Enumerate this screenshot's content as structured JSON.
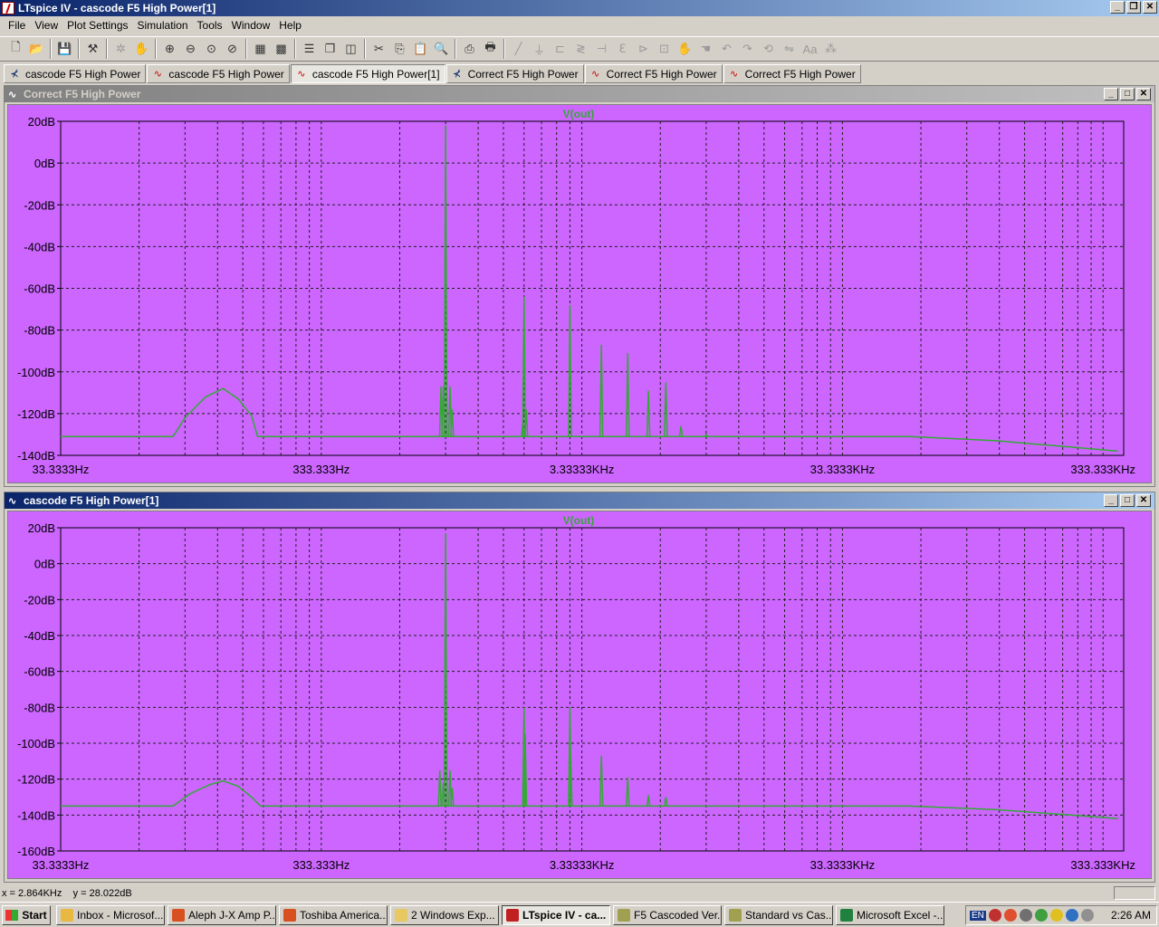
{
  "window": {
    "title": "LTspice IV - cascode F5 High Power[1]"
  },
  "menu": [
    "File",
    "View",
    "Plot Settings",
    "Simulation",
    "Tools",
    "Window",
    "Help"
  ],
  "toolbar_icons": [
    "new-schematic-icon",
    "open-icon",
    "save-icon",
    "control-panel-icon",
    "run-icon",
    "halt-icon",
    "zoom-in-icon",
    "zoom-out-icon",
    "zoom-fit-icon",
    "zoom-cancel-icon",
    "autorange-icon",
    "grid-icon",
    "tile-horizontal-icon",
    "cascade-icon",
    "tile-vertical-icon",
    "cut-icon",
    "copy-icon",
    "paste-icon",
    "find-icon",
    "print-preview-icon",
    "print-icon",
    "wire-icon",
    "ground-icon",
    "label-icon",
    "resistor-icon",
    "capacitor-icon",
    "inductor-icon",
    "diode-icon",
    "component-icon",
    "move-icon",
    "drag-icon",
    "undo-icon",
    "redo-icon",
    "rotate-icon",
    "mirror-icon",
    "text-icon",
    "spice-directive-icon"
  ],
  "tabs": [
    {
      "label": "cascode F5 High Power",
      "icon": "schematic-icon"
    },
    {
      "label": "cascode F5 High Power",
      "icon": "waveform-icon"
    },
    {
      "label": "cascode F5 High Power[1]",
      "icon": "waveform-icon"
    },
    {
      "label": "Correct F5 High Power",
      "icon": "schematic-icon"
    },
    {
      "label": "Correct F5 High Power",
      "icon": "waveform-icon"
    },
    {
      "label": "Correct F5 High Power",
      "icon": "waveform-icon"
    }
  ],
  "plots": [
    {
      "title": "Correct F5 High Power",
      "active": false,
      "trace_label": "V(out)",
      "colors": {
        "background": "#cc66ff",
        "trace": "#33aa33",
        "grid": "#202020"
      },
      "chart_data": {
        "type": "line",
        "x_scale": "log",
        "xlim_hz": [
          33.3333,
          400000
        ],
        "x_tick_labels": [
          "33.3333Hz",
          "333.333Hz",
          "3.33333KHz",
          "33.3333KHz",
          "333.333KHz"
        ],
        "x_tick_values": [
          33.3333,
          333.333,
          3333.33,
          33333.3,
          333333
        ],
        "ylim": [
          -140,
          20
        ],
        "y_tick_labels": [
          "20dB",
          "0dB",
          "-20dB",
          "-40dB",
          "-60dB",
          "-80dB",
          "-100dB",
          "-120dB",
          "-140dB"
        ],
        "y_tick_values": [
          20,
          0,
          -20,
          -40,
          -60,
          -80,
          -100,
          -120,
          -140
        ],
        "grid": true,
        "series": [
          {
            "name": "V(out)",
            "floor": [
              [
                33.3333,
                -131
              ],
              [
                90,
                -131
              ],
              [
                100,
                -122
              ],
              [
                120,
                -112
              ],
              [
                140,
                -108
              ],
              [
                160,
                -113
              ],
              [
                180,
                -121
              ],
              [
                190,
                -131
              ],
              [
                950,
                -131
              ],
              [
                20000,
                -131
              ],
              [
                60000,
                -131
              ],
              [
                130000,
                -133
              ],
              [
                250000,
                -136
              ],
              [
                380000,
                -138
              ]
            ],
            "spikes": [
              [
                960,
                -107
              ],
              [
                980,
                -107
              ],
              [
                1000,
                18
              ],
              [
                1040,
                -107
              ],
              [
                1060,
                -118
              ],
              [
                1980,
                -124
              ],
              [
                2000,
                -64
              ],
              [
                2040,
                -118
              ],
              [
                3000,
                -68
              ],
              [
                3960,
                -87
              ],
              [
                5000,
                -91
              ],
              [
                6000,
                -109
              ],
              [
                7000,
                -105
              ],
              [
                8000,
                -126
              ],
              [
                10000,
                -130
              ]
            ]
          }
        ]
      }
    },
    {
      "title": "cascode F5 High Power[1]",
      "active": true,
      "trace_label": "V(out)",
      "colors": {
        "background": "#cc66ff",
        "trace": "#33aa33",
        "grid": "#202020"
      },
      "chart_data": {
        "type": "line",
        "x_scale": "log",
        "xlim_hz": [
          33.3333,
          400000
        ],
        "x_tick_labels": [
          "33.3333Hz",
          "333.333Hz",
          "3.33333KHz",
          "33.3333KHz",
          "333.333KHz"
        ],
        "x_tick_values": [
          33.3333,
          333.333,
          3333.33,
          33333.3,
          333333
        ],
        "ylim": [
          -160,
          20
        ],
        "y_tick_labels": [
          "20dB",
          "0dB",
          "-20dB",
          "-40dB",
          "-60dB",
          "-80dB",
          "-100dB",
          "-120dB",
          "-140dB",
          "-160dB"
        ],
        "y_tick_values": [
          20,
          0,
          -20,
          -40,
          -60,
          -80,
          -100,
          -120,
          -140,
          -160
        ],
        "grid": true,
        "series": [
          {
            "name": "V(out)",
            "floor": [
              [
                33.3333,
                -135
              ],
              [
                90,
                -135
              ],
              [
                105,
                -128
              ],
              [
                125,
                -123
              ],
              [
                140,
                -121
              ],
              [
                160,
                -124
              ],
              [
                180,
                -130
              ],
              [
                195,
                -135
              ],
              [
                950,
                -135
              ],
              [
                20000,
                -135
              ],
              [
                60000,
                -135
              ],
              [
                130000,
                -137
              ],
              [
                250000,
                -140
              ],
              [
                380000,
                -142
              ]
            ],
            "spikes": [
              [
                950,
                -115
              ],
              [
                980,
                -122
              ],
              [
                1000,
                17
              ],
              [
                1040,
                -115
              ],
              [
                1060,
                -125
              ],
              [
                2000,
                -80
              ],
              [
                2020,
                -95
              ],
              [
                3000,
                -80
              ],
              [
                3020,
                -107
              ],
              [
                3960,
                -107
              ],
              [
                5000,
                -119
              ],
              [
                6000,
                -129
              ],
              [
                7000,
                -130
              ]
            ]
          }
        ]
      }
    }
  ],
  "status": {
    "cursor_readout": "x = 2.864KHz    y = 28.022dB"
  },
  "taskbar": {
    "start_label": "Start",
    "tasks": [
      {
        "label": "Inbox - Microsof...",
        "color": "#e8b840",
        "active": false
      },
      {
        "label": "Aleph J-X Amp P...",
        "color": "#d85020",
        "active": false
      },
      {
        "label": "Toshiba America...",
        "color": "#d85020",
        "active": false
      },
      {
        "label": "2 Windows Exp...",
        "color": "#e8c860",
        "active": false
      },
      {
        "label": "LTspice IV - ca...",
        "color": "#c02020",
        "active": true
      },
      {
        "label": "F5 Cascoded Ver...",
        "color": "#a0a050",
        "active": false
      },
      {
        "label": "Standard vs Cas...",
        "color": "#a0a050",
        "active": false
      },
      {
        "label": "Microsoft Excel -...",
        "color": "#208040",
        "active": false
      }
    ],
    "tray_lang": "EN",
    "clock": "2:26 AM"
  }
}
